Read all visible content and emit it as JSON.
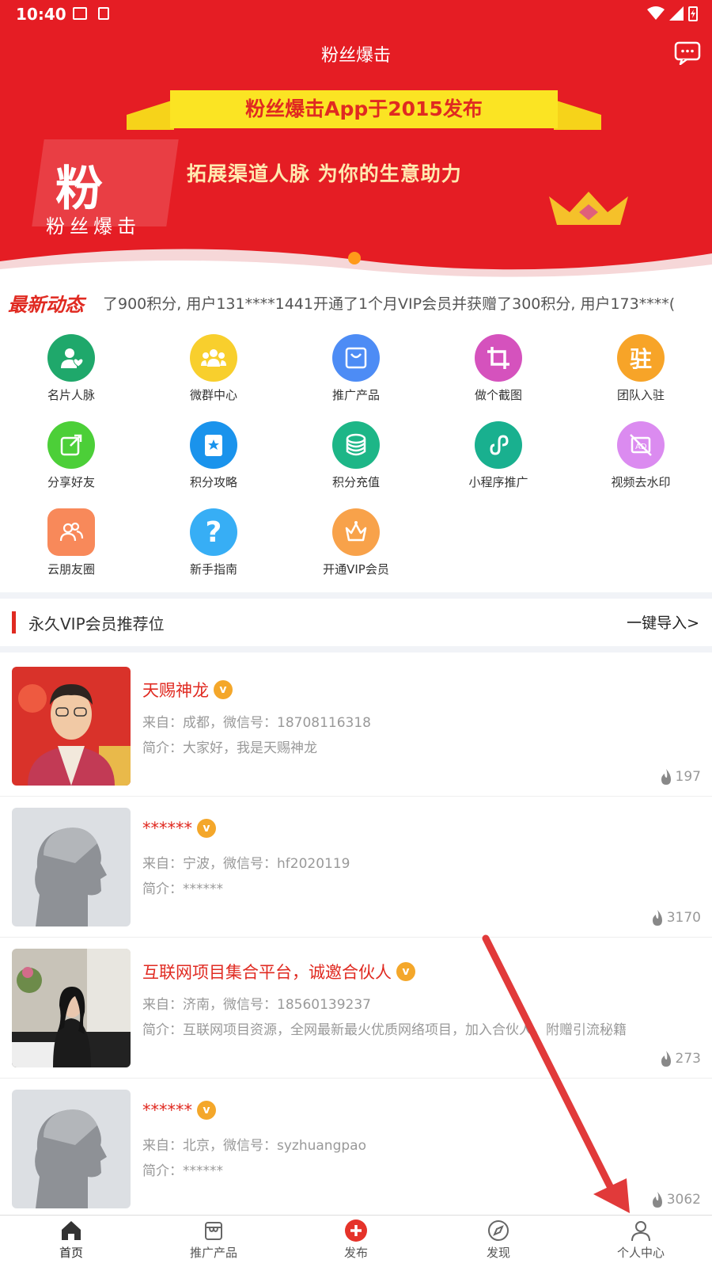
{
  "status_bar": {
    "time": "10:40"
  },
  "header": {
    "title": "粉丝爆击",
    "message_icon": "chat-icon"
  },
  "banner": {
    "ribbon_text": "粉丝爆击App于2015发布",
    "logo_main": "粉",
    "logo_sub": "粉丝爆击",
    "slogan": "拓展渠道人脉 为你的生意助力"
  },
  "news": {
    "tag": "最新动态",
    "text": "了900积分, 用户131****1441开通了1个月VIP会员并获赠了300积分, 用户173****("
  },
  "grid": [
    {
      "label": "名片人脉",
      "icon": "contact-card-icon",
      "color": "#1fa86b"
    },
    {
      "label": "微群中心",
      "icon": "group-icon",
      "color": "#f8cf2d"
    },
    {
      "label": "推广产品",
      "icon": "shopping-bag-icon",
      "color": "#4d8cf5"
    },
    {
      "label": "做个截图",
      "icon": "crop-icon",
      "color": "#d552bd"
    },
    {
      "label": "团队入驻",
      "icon": "team-settle-icon",
      "color": "#f7a428"
    },
    {
      "label": "分享好友",
      "icon": "share-icon",
      "color": "#4ccf38"
    },
    {
      "label": "积分攻略",
      "icon": "guide-book-icon",
      "color": "#1a93ec"
    },
    {
      "label": "积分充值",
      "icon": "coins-icon",
      "color": "#1db687"
    },
    {
      "label": "小程序推广",
      "icon": "mini-program-icon",
      "color": "#19b08f"
    },
    {
      "label": "视频去水印",
      "icon": "no-watermark-icon",
      "color": "#db8bf0"
    },
    {
      "label": "云朋友圈",
      "icon": "friends-circle-icon",
      "color": "#f8895a"
    },
    {
      "label": "新手指南",
      "icon": "help-icon",
      "color": "#37aef5"
    },
    {
      "label": "开通VIP会员",
      "icon": "vip-crown-icon",
      "color": "#f8a24a"
    }
  ],
  "section": {
    "title": "永久VIP会员推荐位",
    "action": "一键导入>"
  },
  "list": [
    {
      "name": "天赐神龙",
      "from": "来自：成都，微信号：18708116318",
      "intro": "简介：大家好，我是天赐神龙",
      "heat": "197",
      "avatar": "photo"
    },
    {
      "name": "******",
      "from": "来自：宁波，微信号：hf2020119",
      "intro": "简介：******",
      "heat": "3170",
      "avatar": "placeholder"
    },
    {
      "name": "互联网项目集合平台，诚邀合伙人",
      "from": "来自：济南，微信号：18560139237",
      "intro": "简介：互联网项目资源，全网最新最火优质网络项目，加入合伙人，附赠引流秘籍",
      "heat": "273",
      "avatar": "photo2"
    },
    {
      "name": "******",
      "from": "来自：北京，微信号：syzhuangpao",
      "intro": "简介：******",
      "heat": "3062",
      "avatar": "placeholder"
    }
  ],
  "vip_badge": "v",
  "nav": [
    {
      "label": "首页",
      "icon": "home-icon",
      "active": true
    },
    {
      "label": "推广产品",
      "icon": "store-icon",
      "active": false
    },
    {
      "label": "发布",
      "icon": "plus-circle-icon",
      "active": false
    },
    {
      "label": "发现",
      "icon": "compass-icon",
      "active": false
    },
    {
      "label": "个人中心",
      "icon": "user-icon",
      "active": false
    }
  ],
  "colors": {
    "brand_red": "#e51d24",
    "accent_orange": "#f4a72a"
  }
}
